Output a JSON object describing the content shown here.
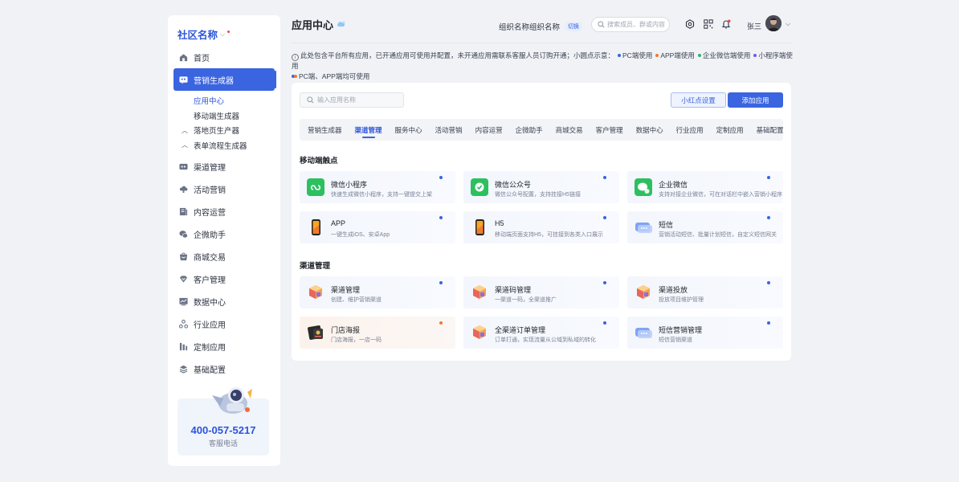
{
  "sidebar": {
    "brand": "社区名称",
    "items": [
      {
        "label": "首页",
        "icon": "home-icon"
      },
      {
        "label": "营销生成器",
        "icon": "marketing-icon",
        "active": true
      },
      {
        "label": "渠道管理",
        "icon": "channel-icon"
      },
      {
        "label": "活动营销",
        "icon": "activity-icon"
      },
      {
        "label": "内容运营",
        "icon": "content-icon"
      },
      {
        "label": "企微助手",
        "icon": "wecom-icon"
      },
      {
        "label": "商城交易",
        "icon": "shop-icon"
      },
      {
        "label": "客户管理",
        "icon": "customer-icon"
      },
      {
        "label": "数据中心",
        "icon": "data-icon"
      },
      {
        "label": "行业应用",
        "icon": "industry-icon"
      },
      {
        "label": "定制应用",
        "icon": "custom-icon"
      },
      {
        "label": "基础配置",
        "icon": "config-icon"
      }
    ],
    "sub_items": [
      {
        "label": "应用中心",
        "active": true,
        "caret": ""
      },
      {
        "label": "移动端生成器",
        "caret": ""
      },
      {
        "label": "落地页生产器",
        "caret": "^"
      },
      {
        "label": "表单流程生成器",
        "caret": "^"
      }
    ],
    "help": {
      "phone": "400-057-5217",
      "label": "客服电话"
    }
  },
  "header": {
    "title": "应用中心",
    "org": "组织名称组织名称",
    "switch": "切换",
    "search_placeholder": "搜索成员、群或内容",
    "user": "张三"
  },
  "notice": {
    "text": "此处包含平台所有应用，已开通应用可使用并配置，未开通应用需联系客服人员订购开通；小圆点示意：",
    "legend": [
      {
        "label": "PC端使用",
        "color": "#3a64e0"
      },
      {
        "label": "APP端使用",
        "color": "#f07a2e"
      },
      {
        "label": "企业微信端使用",
        "color": "#2fb36a"
      },
      {
        "label": "小程序端使用",
        "color": "#6d5ce8"
      }
    ],
    "combo_label": "PC端、APP端均可使用"
  },
  "main": {
    "search_placeholder": "输入应用名称",
    "red_dot_button": "小红点设置",
    "add_button": "添加应用",
    "tabs": [
      "营销生成器",
      "渠道管理",
      "服务中心",
      "活动营销",
      "内容运营",
      "企微助手",
      "商城交易",
      "客户管理",
      "数据中心",
      "行业应用",
      "定制应用",
      "基础配置"
    ],
    "active_tab": 1,
    "sections": [
      {
        "title": "移动端触点",
        "apps": [
          {
            "name": "微信小程序",
            "desc": "快速生成微信小程序，支持一键提交上架",
            "icon": "mini-program-icon",
            "dot": "#3a64e0"
          },
          {
            "name": "微信公众号",
            "desc": "微信公众号配置，支持挂接H5链接",
            "icon": "official-account-icon",
            "dot": "#3a64e0"
          },
          {
            "name": "企业微信",
            "desc": "支持对接企业微信，可在对话栏中嵌入营销小程序",
            "icon": "wecom-app-icon",
            "dot": "#3a64e0"
          },
          {
            "name": "APP",
            "desc": "一键生成iOS、安卓App",
            "icon": "phone-icon",
            "dot": "#3a64e0"
          },
          {
            "name": "H5",
            "desc": "移动端页面支持H5，可挂接到各类入口展示",
            "icon": "phone-icon",
            "dot": "#3a64e0"
          },
          {
            "name": "短信",
            "desc": "营销活动短信、批量计划短信，自定义短信网关",
            "icon": "sms-icon",
            "dot": "#3a64e0"
          }
        ]
      },
      {
        "title": "渠道管理",
        "apps": [
          {
            "name": "渠道管理",
            "desc": "创建、维护营销渠道",
            "icon": "box-icon",
            "dot": "#3a64e0"
          },
          {
            "name": "渠道码管理",
            "desc": "一渠道一码，全渠道推广",
            "icon": "box-icon",
            "dot": "#3a64e0"
          },
          {
            "name": "渠道投放",
            "desc": "投放项目维护管理",
            "icon": "box-icon",
            "dot": "#3a64e0"
          },
          {
            "name": "门店海报",
            "desc": "门店海报，一店一码",
            "icon": "poster-icon",
            "dot": "#f07a2e",
            "warm": true
          },
          {
            "name": "全渠道订单管理",
            "desc": "订单打通，实现流量从公域到私域的转化",
            "icon": "box-icon",
            "dot": "#3a64e0"
          },
          {
            "name": "短信营销管理",
            "desc": "短信营销渠道",
            "icon": "sms-icon",
            "dot": "#3a64e0"
          }
        ]
      }
    ]
  }
}
